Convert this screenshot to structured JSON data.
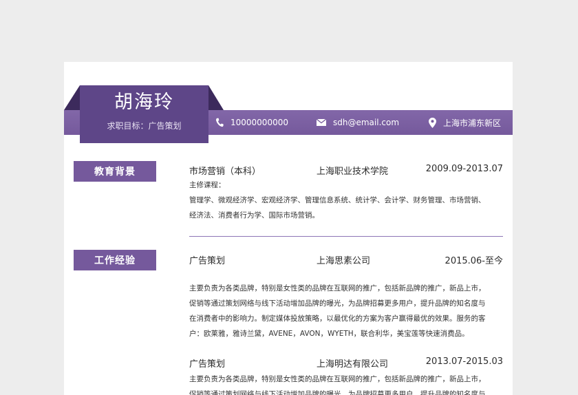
{
  "header": {
    "name": "胡海玲",
    "goal": "求职目标：广告策划",
    "phone": "10000000000",
    "email": "sdh@email.com",
    "location": "上海市浦东新区"
  },
  "education": {
    "title": "教育背景",
    "major": "市场营销（本科）",
    "school": "上海职业技术学院",
    "period": "2009.09-2013.07",
    "courses_label": "主修课程：",
    "courses_line1": "管理学、微观经济学、宏观经济学、管理信息系统、统计学、会计学、财务管理、市场营销、",
    "courses_line2": "经济法、消费者行为学、国际市场营销。"
  },
  "work": {
    "title": "工作经验",
    "jobs": [
      {
        "position": "广告策划",
        "company": "上海思素公司",
        "period": "2015.06-至今",
        "desc_lines": [
          "主要负责为各类品牌，特别是女性类的品牌在互联网的推广，包括新品牌的推广，新品上市，",
          "促销等通过策划网络与线下活动增加品牌的曝光，为品牌招募更多用户，提升品牌的知名度与",
          "在消费者中的影响力。制定媒体投放策略，以最优化的方案为客户赢得最优的效果。服务的客",
          "户：欧莱雅，雅诗兰黛，AVENE，AVON，WYETH，联合利华，美宝莲等快速消费品。"
        ]
      },
      {
        "position": "广告策划",
        "company": "上海明达有限公司",
        "period": "2013.07-2015.03",
        "desc_lines": [
          "主要负责为各类品牌，特别是女性类的品牌在互联网的推广，包括新品牌的推广，新品上市，",
          "促销等通过策划网络与线下活动增加品牌的曝光，为品牌招募更多用户，提升品牌的知名度与"
        ]
      }
    ]
  },
  "icons": [
    "phone-icon",
    "email-icon",
    "location-pin-icon"
  ],
  "colors": {
    "accent": "#75599c",
    "dark": "#5e4688",
    "fold": "#3c2a5c"
  }
}
